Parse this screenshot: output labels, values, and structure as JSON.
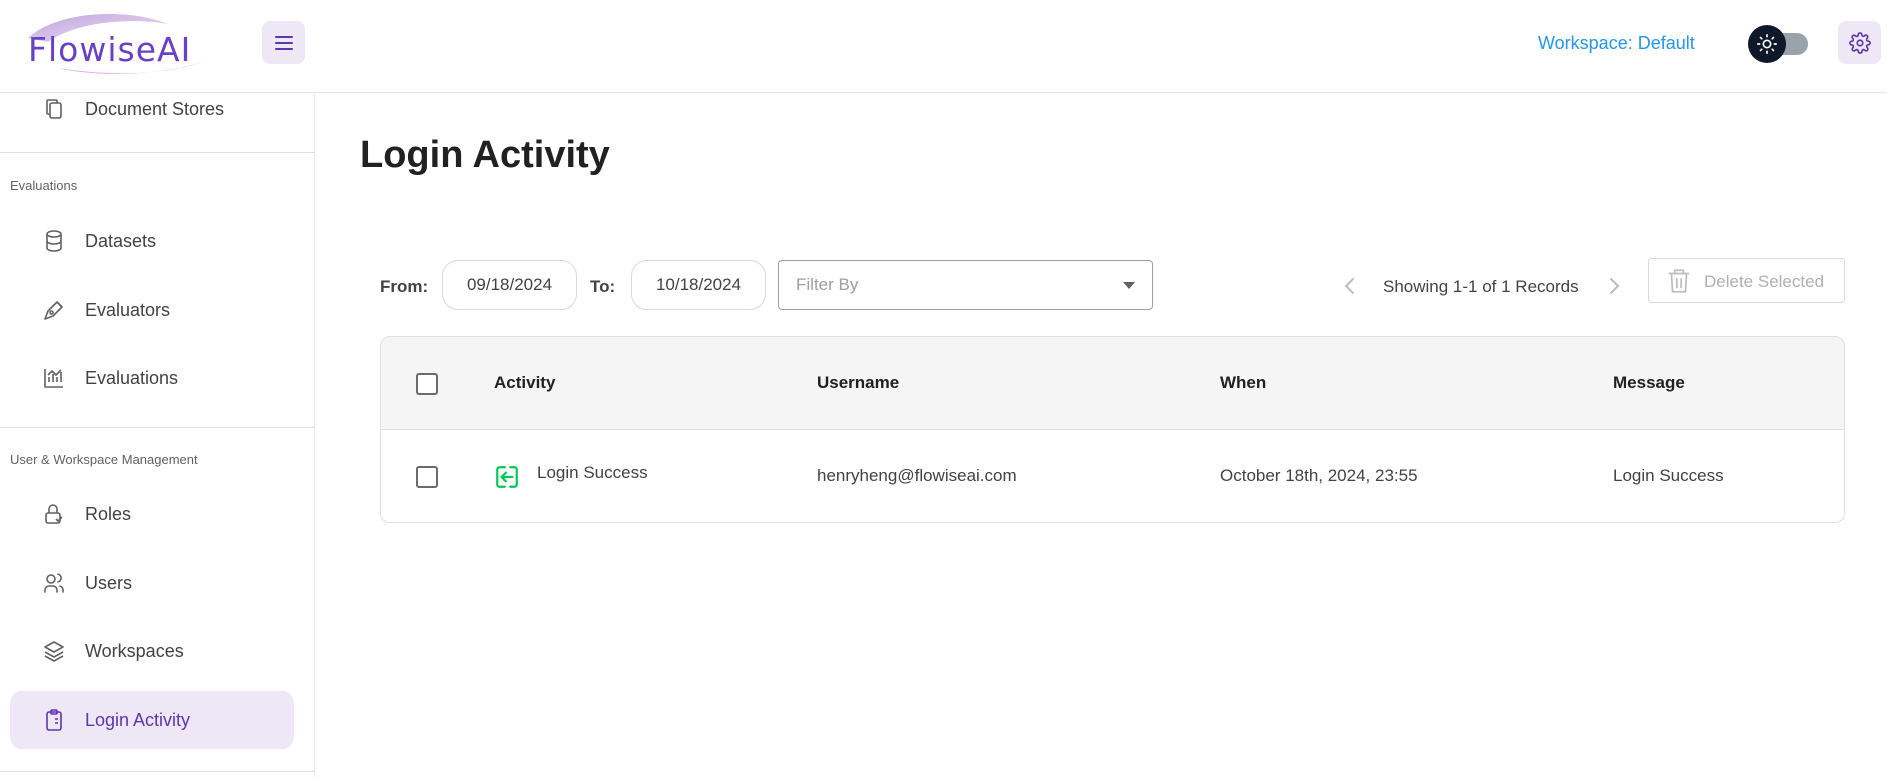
{
  "app": {
    "logo_text": "FlowiseAI",
    "workspace_label": "Workspace: Default",
    "accent_color": "#5e35b1",
    "link_color": "#2196f3"
  },
  "sidebar": {
    "items_top": [
      {
        "label": "Document Stores",
        "icon": "document-stores-icon"
      }
    ],
    "sections": [
      {
        "title": "Evaluations",
        "items": [
          {
            "label": "Datasets",
            "icon": "database-icon"
          },
          {
            "label": "Evaluators",
            "icon": "pen-tool-icon"
          },
          {
            "label": "Evaluations",
            "icon": "chart-icon"
          }
        ]
      },
      {
        "title": "User & Workspace Management",
        "items": [
          {
            "label": "Roles",
            "icon": "lock-check-icon"
          },
          {
            "label": "Users",
            "icon": "users-icon"
          },
          {
            "label": "Workspaces",
            "icon": "layers-icon"
          },
          {
            "label": "Login Activity",
            "icon": "clipboard-icon",
            "active": true
          }
        ]
      }
    ]
  },
  "main": {
    "title": "Login Activity",
    "filters": {
      "from_label": "From:",
      "from_value": "09/18/2024",
      "to_label": "To:",
      "to_value": "10/18/2024",
      "filter_placeholder": "Filter By"
    },
    "pagination": {
      "text": "Showing 1-1 of 1 Records"
    },
    "delete_label": "Delete Selected",
    "table": {
      "columns": [
        "Activity",
        "Username",
        "When",
        "Message"
      ],
      "rows": [
        {
          "activity": "Login Success",
          "activity_icon": "login-icon",
          "username": "henryheng@flowiseai.com",
          "when": "October 18th, 2024, 23:55",
          "message": "Login Success"
        }
      ]
    }
  }
}
